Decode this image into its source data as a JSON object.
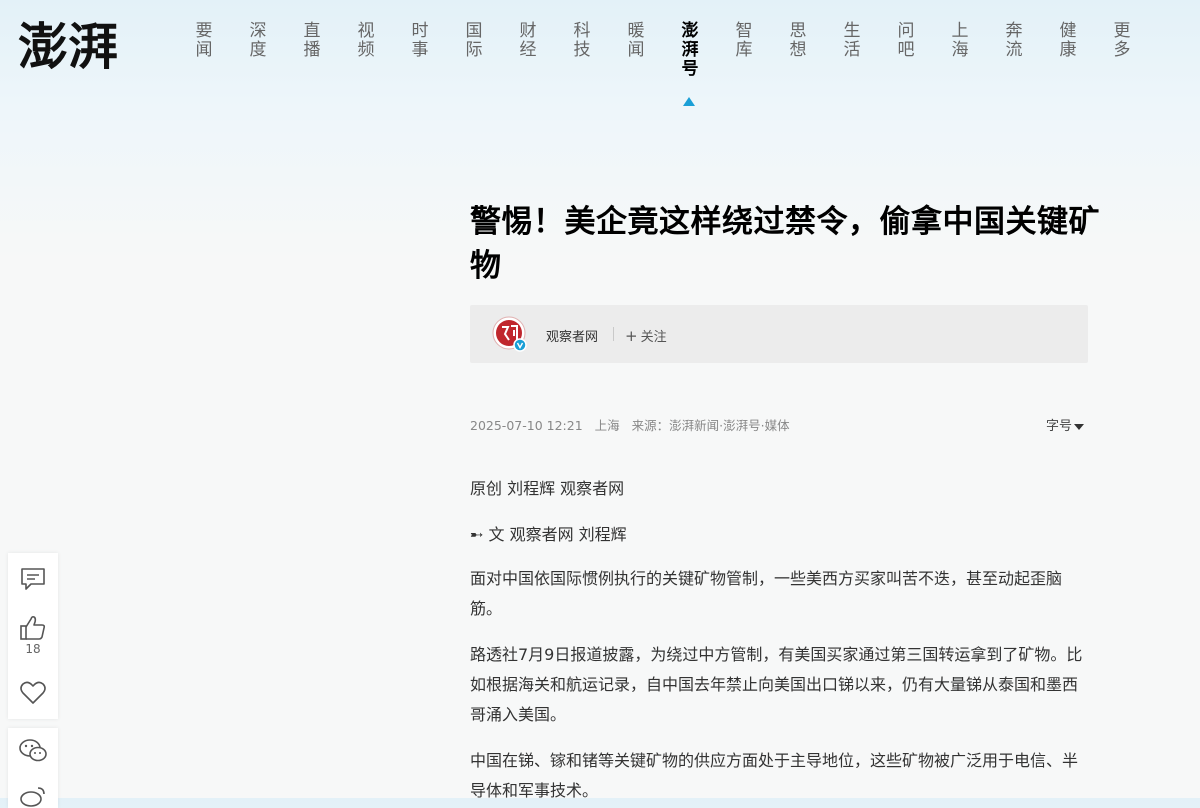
{
  "logo_text": "澎湃",
  "nav": [
    {
      "label": "要闻"
    },
    {
      "label": "深度"
    },
    {
      "label": "直播"
    },
    {
      "label": "视频"
    },
    {
      "label": "时事"
    },
    {
      "label": "国际"
    },
    {
      "label": "财经"
    },
    {
      "label": "科技"
    },
    {
      "label": "暖闻"
    },
    {
      "label": "澎湃号",
      "active": true
    },
    {
      "label": "智库"
    },
    {
      "label": "思想"
    },
    {
      "label": "生活"
    },
    {
      "label": "问吧"
    },
    {
      "label": "上海"
    },
    {
      "label": "奔流"
    },
    {
      "label": "健康"
    },
    {
      "label": "更多"
    }
  ],
  "article": {
    "title": "警惕！美企竟这样绕过禁令，偷拿中国关键矿物",
    "author": "观察者网",
    "follow_label": "关注",
    "date": "2025-07-10 12:21",
    "location": "上海",
    "source": "来源：澎湃新闻·澎湃号·媒体",
    "font_size_label": "字号",
    "paragraphs": [
      "原创 刘程辉 观察者网",
      "➸ 文 观察者网 刘程辉",
      "面对中国依国际惯例执行的关键矿物管制，一些美西方买家叫苦不迭，甚至动起歪脑筋。",
      "路透社7月9日报道披露，为绕过中方管制，有美国买家通过第三国转运拿到了矿物。比如根据海关和航运记录，自中国去年禁止向美国出口锑以来，仍有大量锑从泰国和墨西哥涌入美国。",
      "中国在锑、镓和锗等关键矿物的供应方面处于主导地位，这些矿物被广泛用于电信、半导体和军事技术。"
    ]
  },
  "sidebar": {
    "like_count": "18"
  },
  "colors": {
    "accent": "#1a9fd6",
    "avatar_red": "#c0272d"
  }
}
